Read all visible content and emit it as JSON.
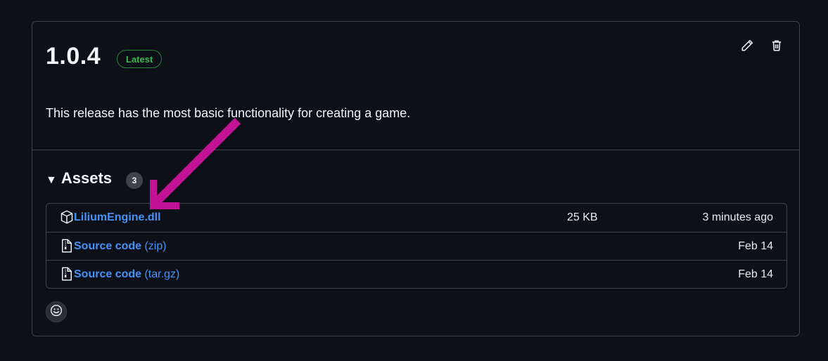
{
  "release": {
    "version": "1.0.4",
    "badge": "Latest",
    "description": "This release has the most basic functionality for creating a game.",
    "edit_icon": "pencil-icon",
    "delete_icon": "trash-icon"
  },
  "assets": {
    "title": "Assets",
    "count": "3",
    "items": [
      {
        "name": "LiliumEngine.dll",
        "ext": "",
        "size": "25 KB",
        "date": "3 minutes ago",
        "icon": "package-icon"
      },
      {
        "name": "Source code",
        "ext": " (zip)",
        "size": "",
        "date": "Feb 14",
        "icon": "file-zip-icon"
      },
      {
        "name": "Source code",
        "ext": " (tar.gz)",
        "size": "",
        "date": "Feb 14",
        "icon": "file-zip-icon"
      }
    ]
  },
  "colors": {
    "background": "#0d1117",
    "link": "#4493f8",
    "badge_green": "#3fb950",
    "annotation_arrow": "#c21296"
  },
  "annotation": {
    "type": "arrow",
    "points_to": "LiliumEngine.dll"
  }
}
